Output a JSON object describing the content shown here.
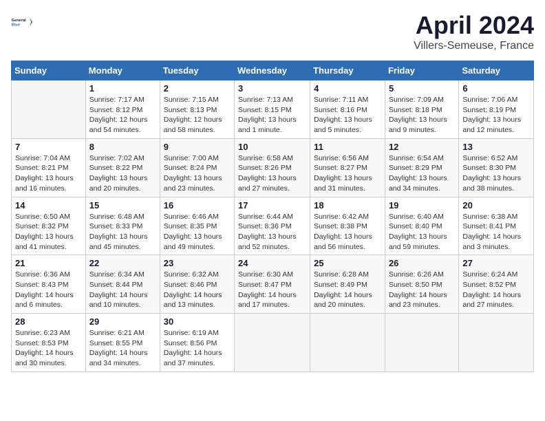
{
  "header": {
    "logo_line1": "General",
    "logo_line2": "Blue",
    "title": "April 2024",
    "subtitle": "Villers-Semeuse, France"
  },
  "weekdays": [
    "Sunday",
    "Monday",
    "Tuesday",
    "Wednesday",
    "Thursday",
    "Friday",
    "Saturday"
  ],
  "weeks": [
    [
      {
        "day": "",
        "info": ""
      },
      {
        "day": "1",
        "info": "Sunrise: 7:17 AM\nSunset: 8:12 PM\nDaylight: 12 hours\nand 54 minutes."
      },
      {
        "day": "2",
        "info": "Sunrise: 7:15 AM\nSunset: 8:13 PM\nDaylight: 12 hours\nand 58 minutes."
      },
      {
        "day": "3",
        "info": "Sunrise: 7:13 AM\nSunset: 8:15 PM\nDaylight: 13 hours\nand 1 minute."
      },
      {
        "day": "4",
        "info": "Sunrise: 7:11 AM\nSunset: 8:16 PM\nDaylight: 13 hours\nand 5 minutes."
      },
      {
        "day": "5",
        "info": "Sunrise: 7:09 AM\nSunset: 8:18 PM\nDaylight: 13 hours\nand 9 minutes."
      },
      {
        "day": "6",
        "info": "Sunrise: 7:06 AM\nSunset: 8:19 PM\nDaylight: 13 hours\nand 12 minutes."
      }
    ],
    [
      {
        "day": "7",
        "info": "Sunrise: 7:04 AM\nSunset: 8:21 PM\nDaylight: 13 hours\nand 16 minutes."
      },
      {
        "day": "8",
        "info": "Sunrise: 7:02 AM\nSunset: 8:22 PM\nDaylight: 13 hours\nand 20 minutes."
      },
      {
        "day": "9",
        "info": "Sunrise: 7:00 AM\nSunset: 8:24 PM\nDaylight: 13 hours\nand 23 minutes."
      },
      {
        "day": "10",
        "info": "Sunrise: 6:58 AM\nSunset: 8:26 PM\nDaylight: 13 hours\nand 27 minutes."
      },
      {
        "day": "11",
        "info": "Sunrise: 6:56 AM\nSunset: 8:27 PM\nDaylight: 13 hours\nand 31 minutes."
      },
      {
        "day": "12",
        "info": "Sunrise: 6:54 AM\nSunset: 8:29 PM\nDaylight: 13 hours\nand 34 minutes."
      },
      {
        "day": "13",
        "info": "Sunrise: 6:52 AM\nSunset: 8:30 PM\nDaylight: 13 hours\nand 38 minutes."
      }
    ],
    [
      {
        "day": "14",
        "info": "Sunrise: 6:50 AM\nSunset: 8:32 PM\nDaylight: 13 hours\nand 41 minutes."
      },
      {
        "day": "15",
        "info": "Sunrise: 6:48 AM\nSunset: 8:33 PM\nDaylight: 13 hours\nand 45 minutes."
      },
      {
        "day": "16",
        "info": "Sunrise: 6:46 AM\nSunset: 8:35 PM\nDaylight: 13 hours\nand 49 minutes."
      },
      {
        "day": "17",
        "info": "Sunrise: 6:44 AM\nSunset: 8:36 PM\nDaylight: 13 hours\nand 52 minutes."
      },
      {
        "day": "18",
        "info": "Sunrise: 6:42 AM\nSunset: 8:38 PM\nDaylight: 13 hours\nand 56 minutes."
      },
      {
        "day": "19",
        "info": "Sunrise: 6:40 AM\nSunset: 8:40 PM\nDaylight: 13 hours\nand 59 minutes."
      },
      {
        "day": "20",
        "info": "Sunrise: 6:38 AM\nSunset: 8:41 PM\nDaylight: 14 hours\nand 3 minutes."
      }
    ],
    [
      {
        "day": "21",
        "info": "Sunrise: 6:36 AM\nSunset: 8:43 PM\nDaylight: 14 hours\nand 6 minutes."
      },
      {
        "day": "22",
        "info": "Sunrise: 6:34 AM\nSunset: 8:44 PM\nDaylight: 14 hours\nand 10 minutes."
      },
      {
        "day": "23",
        "info": "Sunrise: 6:32 AM\nSunset: 8:46 PM\nDaylight: 14 hours\nand 13 minutes."
      },
      {
        "day": "24",
        "info": "Sunrise: 6:30 AM\nSunset: 8:47 PM\nDaylight: 14 hours\nand 17 minutes."
      },
      {
        "day": "25",
        "info": "Sunrise: 6:28 AM\nSunset: 8:49 PM\nDaylight: 14 hours\nand 20 minutes."
      },
      {
        "day": "26",
        "info": "Sunrise: 6:26 AM\nSunset: 8:50 PM\nDaylight: 14 hours\nand 23 minutes."
      },
      {
        "day": "27",
        "info": "Sunrise: 6:24 AM\nSunset: 8:52 PM\nDaylight: 14 hours\nand 27 minutes."
      }
    ],
    [
      {
        "day": "28",
        "info": "Sunrise: 6:23 AM\nSunset: 8:53 PM\nDaylight: 14 hours\nand 30 minutes."
      },
      {
        "day": "29",
        "info": "Sunrise: 6:21 AM\nSunset: 8:55 PM\nDaylight: 14 hours\nand 34 minutes."
      },
      {
        "day": "30",
        "info": "Sunrise: 6:19 AM\nSunset: 8:56 PM\nDaylight: 14 hours\nand 37 minutes."
      },
      {
        "day": "",
        "info": ""
      },
      {
        "day": "",
        "info": ""
      },
      {
        "day": "",
        "info": ""
      },
      {
        "day": "",
        "info": ""
      }
    ]
  ]
}
